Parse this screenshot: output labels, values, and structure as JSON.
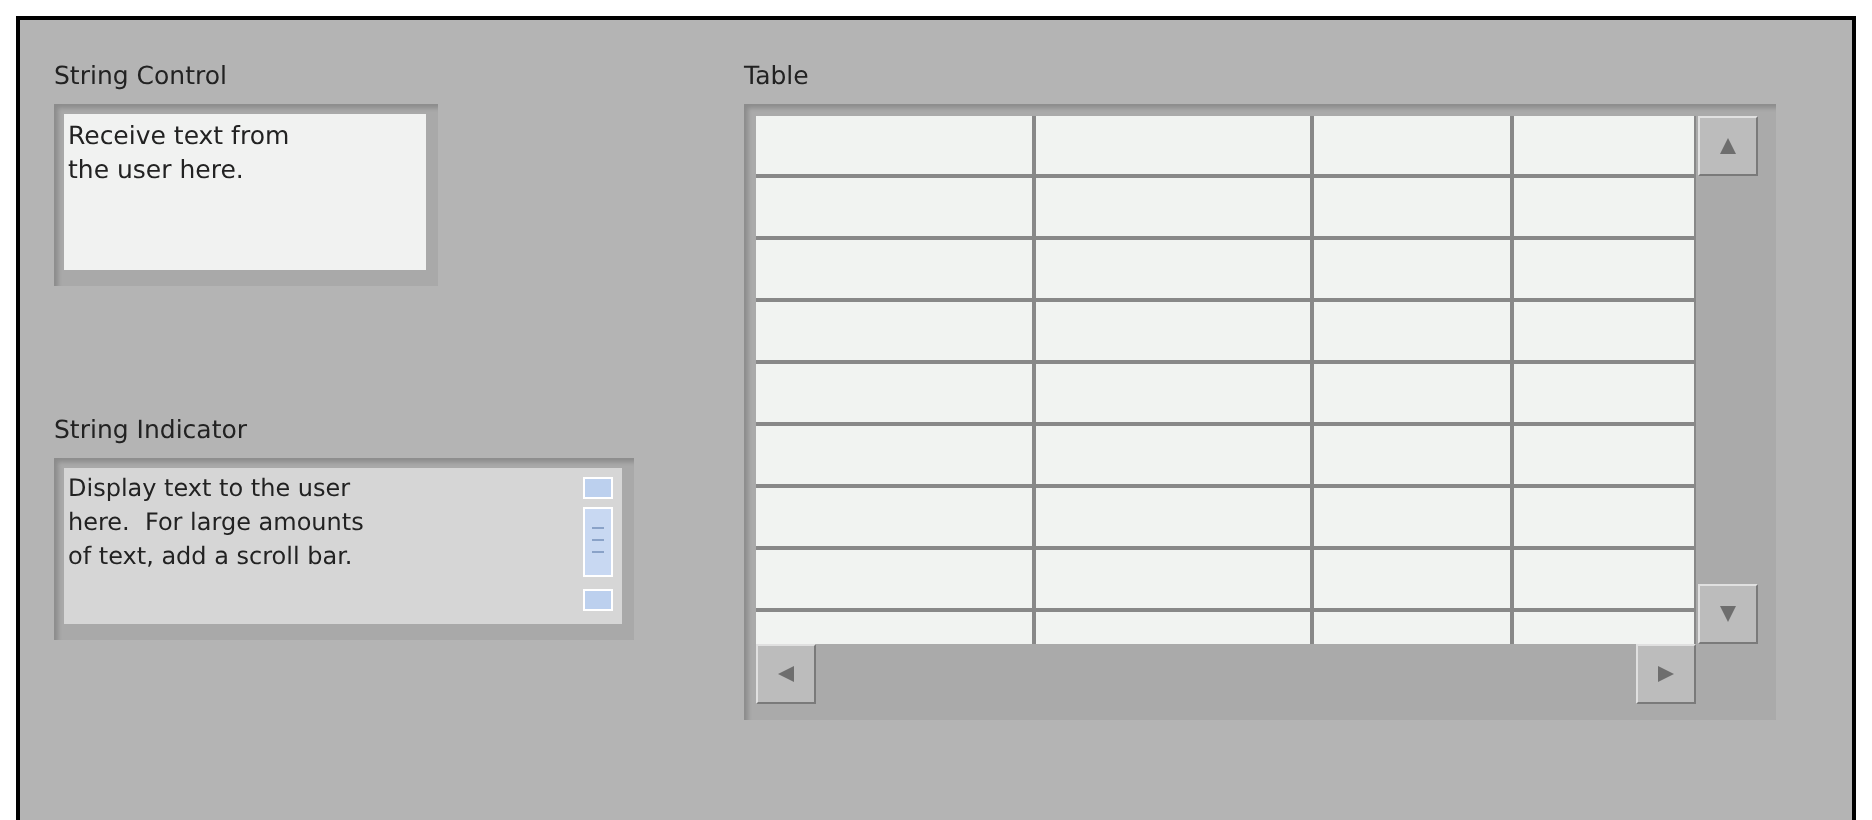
{
  "string_control": {
    "label": "String Control",
    "value_lines": [
      "Receive text from",
      "the user here."
    ]
  },
  "string_indicator": {
    "label": "String Indicator",
    "value_lines": [
      "Display text to the user",
      "here.  For large amounts",
      "of text, add a scroll bar."
    ]
  },
  "table": {
    "label": "Table"
  }
}
